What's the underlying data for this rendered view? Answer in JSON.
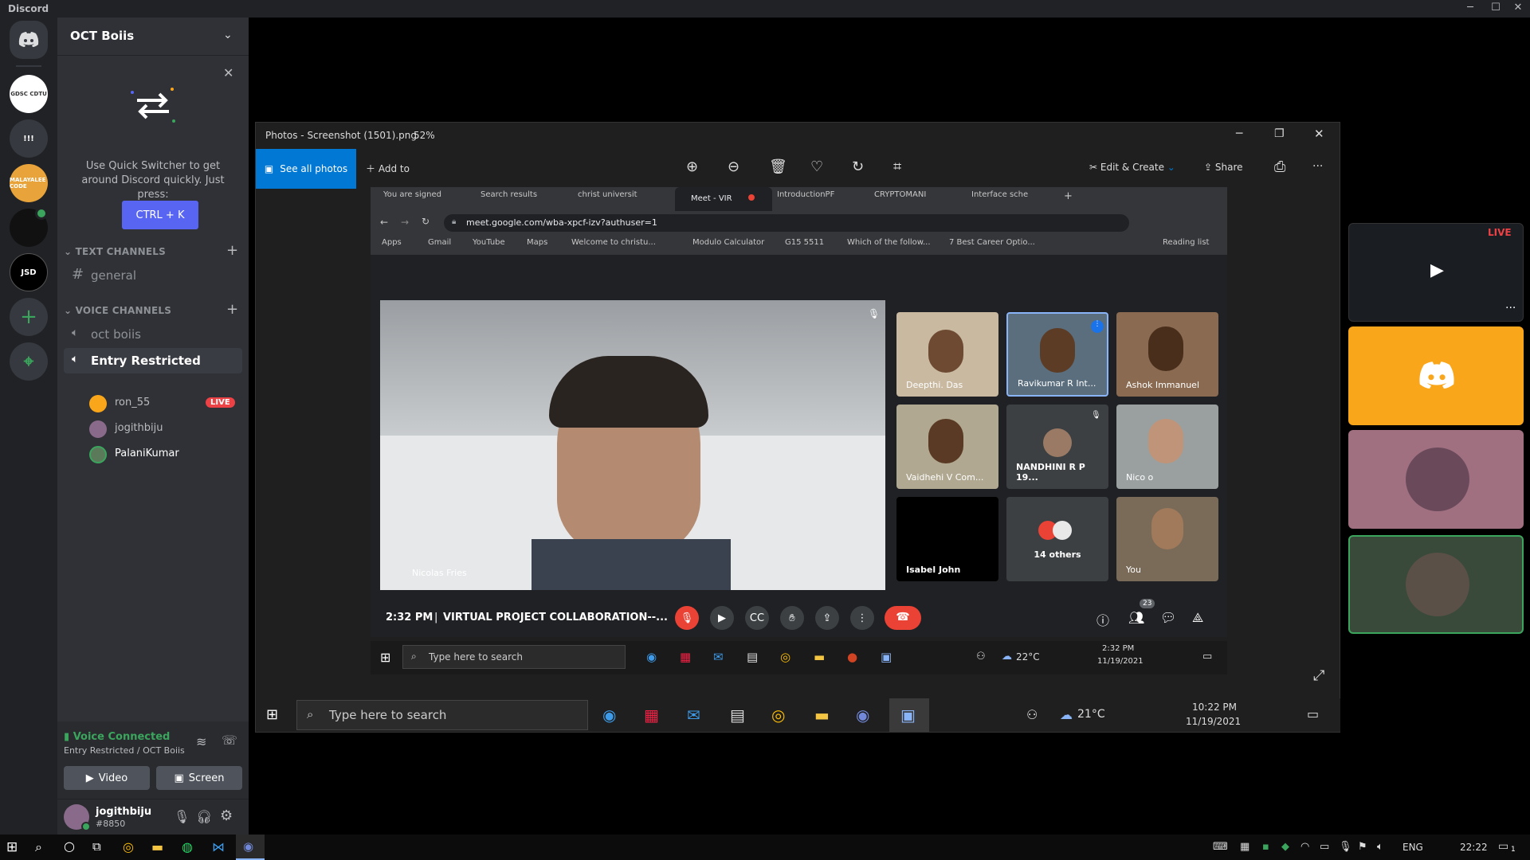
{
  "titlebar": {
    "app": "Discord",
    "min": "─",
    "max": "☐",
    "close": "✕"
  },
  "rail": {
    "servers": [
      "GDSC CDTU",
      "!!!",
      "MALAYALEE CODE",
      "",
      "JSD"
    ],
    "add": "+",
    "explore": "⌖"
  },
  "guild": {
    "name": "OCT Boiis"
  },
  "quickswitcher": {
    "text": "Use Quick Switcher to get around Discord quickly. Just press:",
    "shortcut": "CTRL + K"
  },
  "text_channels": {
    "header": "TEXT CHANNELS",
    "items": [
      "general"
    ]
  },
  "voice_channels": {
    "header": "VOICE CHANNELS",
    "items": [
      "oct boiis",
      "Entry Restricted"
    ],
    "users": [
      {
        "name": "ron_55",
        "badge": "LIVE",
        "color": "#faa61a"
      },
      {
        "name": "jogithbiju",
        "badge": "",
        "color": "#8a6a8a"
      },
      {
        "name": "PalaniKumar",
        "badge": "",
        "color": "#5a7a5a"
      }
    ]
  },
  "voice_panel": {
    "status": "Voice Connected",
    "location": "Entry Restricted / OCT Boiis",
    "video": "Video",
    "screen": "Screen"
  },
  "user_panel": {
    "name": "jogithbiju",
    "tag": "#8850"
  },
  "photos": {
    "title": "Photos - Screenshot (1501).png",
    "zoom": "52%",
    "see_all": "See all photos",
    "add_to": "Add to",
    "edit": "Edit & Create",
    "share": "Share",
    "more": "···"
  },
  "chrome": {
    "tabs": [
      "You are signed",
      "Search results",
      "christ universit",
      "Meet - VIR",
      "IntroductionPF",
      "CRYPTOMANI",
      "Interface sche"
    ],
    "url": "meet.google.com/wba-xpcf-izv?authuser=1",
    "bookmarks": [
      "Apps",
      "Gmail",
      "YouTube",
      "Maps",
      "Welcome to christu...",
      "Modulo Calculator",
      "G15 5511",
      "Which of the follow...",
      "7 Best Career Optio..."
    ],
    "reading_list": "Reading list"
  },
  "meet": {
    "main_name": "Nicolas Fries",
    "participants": [
      "Deepthi. Das",
      "Ravikumar R Int...",
      "Ashok Immanuel",
      "Vaidhehi V Com...",
      "NANDHINI R P 19...",
      "Nico o",
      "Isabel John",
      "14 others",
      "You"
    ],
    "time": "2:32 PM",
    "meeting": "VIRTUAL PROJECT COLLABORATION--...",
    "people_count": "23"
  },
  "inner_taskbar": {
    "search": "Type here to search",
    "temp": "22°C",
    "time": "2:32 PM",
    "date": "11/19/2021"
  },
  "outer_taskbar": {
    "search": "Type here to search",
    "temp": "21°C",
    "time": "10:22 PM",
    "date": "11/19/2021"
  },
  "previews": {
    "live": "LIVE"
  },
  "win_taskbar": {
    "lang": "ENG",
    "time": "22:22",
    "notif": "1"
  },
  "colors": {
    "blurple": "#5865f2",
    "live_red": "#ed4245",
    "green": "#3ba55d",
    "orange": "#faa61a"
  }
}
